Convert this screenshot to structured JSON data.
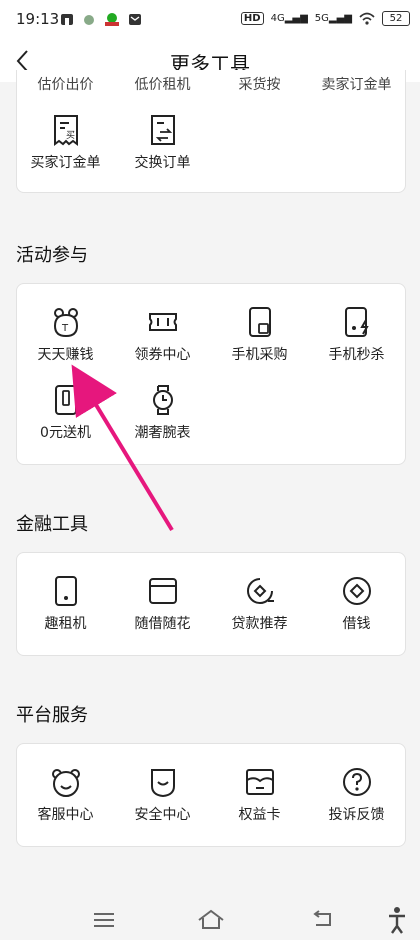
{
  "status": {
    "time": "19:13",
    "battery": "52",
    "net1": "4G",
    "net2": "5G",
    "hd": "HD"
  },
  "header": {
    "title": "更多工具"
  },
  "top_section": {
    "cut_labels": [
      "估价出价",
      "低价租机",
      "采货按",
      "卖家订金单"
    ],
    "items": [
      {
        "label": "买家订金单",
        "icon": "receipt-buy-icon"
      },
      {
        "label": "交换订单",
        "icon": "exchange-order-icon"
      }
    ]
  },
  "activity": {
    "title": "活动参与",
    "items": [
      {
        "label": "天天赚钱",
        "icon": "money-bag-icon"
      },
      {
        "label": "领券中心",
        "icon": "coupon-icon"
      },
      {
        "label": "手机采购",
        "icon": "phone-purchase-icon"
      },
      {
        "label": "手机秒杀",
        "icon": "phone-flash-sale-icon"
      },
      {
        "label": "0元送机",
        "icon": "free-phone-icon"
      },
      {
        "label": "潮奢腕表",
        "icon": "watch-icon"
      }
    ]
  },
  "finance": {
    "title": "金融工具",
    "items": [
      {
        "label": "趣租机",
        "icon": "rent-phone-icon"
      },
      {
        "label": "随借随花",
        "icon": "card-icon"
      },
      {
        "label": "贷款推荐",
        "icon": "loan-icon"
      },
      {
        "label": "借钱",
        "icon": "borrow-icon"
      }
    ]
  },
  "services": {
    "title": "平台服务",
    "items": [
      {
        "label": "客服中心",
        "icon": "bear-face-icon"
      },
      {
        "label": "安全中心",
        "icon": "shield-smile-icon"
      },
      {
        "label": "权益卡",
        "icon": "benefit-card-icon"
      },
      {
        "label": "投诉反馈",
        "icon": "question-icon"
      }
    ]
  },
  "accent": "#e6177d"
}
